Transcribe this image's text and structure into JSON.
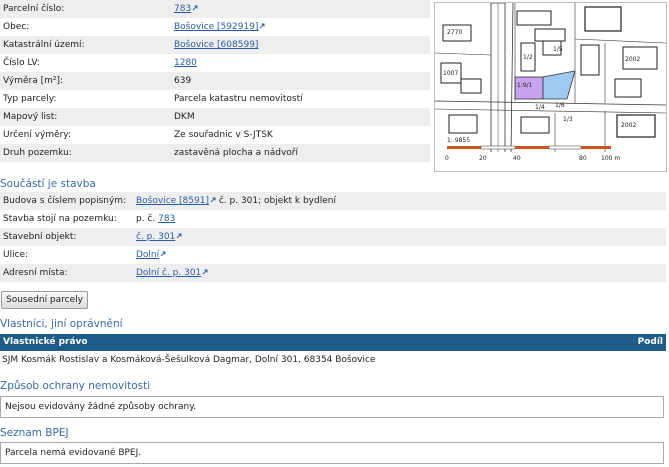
{
  "parcel": {
    "rows": [
      {
        "label": "Parcelní číslo:",
        "value": "783",
        "link": true,
        "ext": true
      },
      {
        "label": "Obec:",
        "value": "Bošovice [592919]",
        "link": true,
        "ext": true
      },
      {
        "label": "Katastrální území:",
        "value": "Bošovice [608599]",
        "link": true,
        "ext": false
      },
      {
        "label": "Číslo LV:",
        "value": "1280",
        "link": true,
        "ext": false
      },
      {
        "label": "Výměra [m²]:",
        "value": "639",
        "link": false,
        "ext": false
      },
      {
        "label": "Typ parcely:",
        "value": "Parcela katastru nemovitostí",
        "link": false,
        "ext": false
      },
      {
        "label": "Mapový list:",
        "value": "DKM",
        "link": false,
        "ext": false
      },
      {
        "label": "Určení výměry:",
        "value": "Ze souřadnic v S-JTSK",
        "link": false,
        "ext": false
      },
      {
        "label": "Druh pozemku:",
        "value": "zastavěná plocha a nádvoří",
        "link": false,
        "ext": false
      }
    ]
  },
  "map": {
    "scale_labels": [
      "0",
      "20",
      "40",
      "80",
      "100 m"
    ],
    "parcel_labels": [
      "1: 9855",
      "1:9/1",
      "2770",
      "1007",
      "2002",
      "2002",
      "1/2",
      "1/5",
      "1/4",
      "1/6",
      "1/3"
    ],
    "colors": {
      "parcel_fill": "#c9a2f0",
      "neighbor_fill": "#9ec9f2",
      "scale_accent": "#c8571d"
    }
  },
  "soucasti": {
    "title": "Součástí je stavba",
    "rows": [
      {
        "label": "Budova s číslem popisným:",
        "link": "Bošovice [8591]",
        "ext": true,
        "suffix": " č. p. 301; objekt k bydlení"
      },
      {
        "label": "Stavba stojí na pozemku:",
        "prefix": "p. č. ",
        "link": "783",
        "ext": false,
        "suffix": ""
      },
      {
        "label": "Stavební objekt:",
        "link": "č. p. 301",
        "ext": true,
        "suffix": ""
      },
      {
        "label": "Ulice:",
        "link": "Dolní",
        "ext": true,
        "suffix": ""
      },
      {
        "label": "Adresní místa:",
        "link": "Dolní č. p. 301",
        "ext": true,
        "suffix": ""
      }
    ]
  },
  "buttons": {
    "neighbors": "Sousední parcely"
  },
  "owners": {
    "title": "Vlastníci, jiní oprávnění",
    "head_left": "Vlastnické právo",
    "head_right": "Podíl",
    "row": "SJM Kosmák Rostislav a Kosmáková-Šešulková Dagmar, Dolní 301, 68354 Bošovice"
  },
  "ochrana": {
    "title": "Způsob ochrany nemovitosti",
    "text": "Nejsou evidovány žádné způsoby ochrany."
  },
  "bpej": {
    "title": "Seznam BPEJ",
    "text": "Parcela nemá evidované BPEJ."
  }
}
